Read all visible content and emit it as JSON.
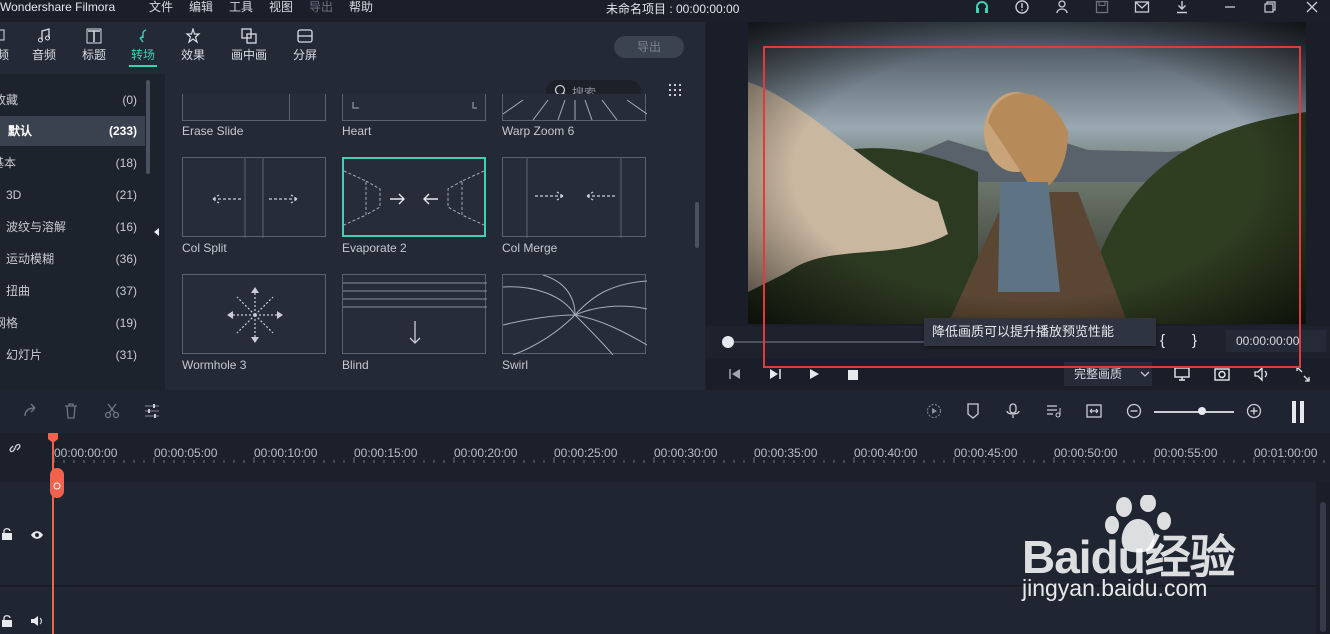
{
  "app": {
    "name": "Wondershare Filmora",
    "project_title": "未命名项目 : 00:00:00:00"
  },
  "menu": [
    "文件",
    "编辑",
    "工具",
    "视图",
    "导出",
    "帮助"
  ],
  "nav_tabs": [
    {
      "label": "频",
      "icon": "media-icon"
    },
    {
      "label": "音频",
      "icon": "music-note-icon"
    },
    {
      "label": "标题",
      "icon": "text-icon"
    },
    {
      "label": "转场",
      "icon": "transition-icon",
      "active": true
    },
    {
      "label": "效果",
      "icon": "effects-icon"
    },
    {
      "label": "画中画",
      "icon": "pip-icon"
    },
    {
      "label": "分屏",
      "icon": "split-screen-icon"
    }
  ],
  "export_label": "导出",
  "search_placeholder": "搜索",
  "categories": [
    {
      "name": "收藏",
      "count": "(0)"
    },
    {
      "name": "默认",
      "count": "(233)",
      "active": true
    },
    {
      "name": "基本",
      "count": "(18)"
    },
    {
      "name": "3D",
      "count": "(21)"
    },
    {
      "name": "波纹与溶解",
      "count": "(16)"
    },
    {
      "name": "运动模糊",
      "count": "(36)"
    },
    {
      "name": "扭曲",
      "count": "(37)"
    },
    {
      "name": "网格",
      "count": "(19)"
    },
    {
      "name": "幻灯片",
      "count": "(31)"
    }
  ],
  "transitions": [
    {
      "label": "Erase Slide"
    },
    {
      "label": "Heart"
    },
    {
      "label": "Warp Zoom 6"
    },
    {
      "label": "Col Split"
    },
    {
      "label": "Evaporate 2",
      "selected": true
    },
    {
      "label": "Col Merge"
    },
    {
      "label": "Wormhole 3"
    },
    {
      "label": "Blind"
    },
    {
      "label": "Swirl"
    }
  ],
  "player": {
    "tooltip": "降低画质可以提升播放预览性能",
    "timecode": "00:00:00:00",
    "quality": "完整画质",
    "progress": 0
  },
  "timeline": {
    "ruler": [
      "00:00:00:00",
      "00:00:05:00",
      "00:00:10:00",
      "00:00:15:00",
      "00:00:20:00",
      "00:00:25:00",
      "00:00:30:00",
      "00:00:35:00",
      "00:00:40:00",
      "00:00:45:00",
      "00:00:50:00",
      "00:00:55:00",
      "00:01:00:00"
    ],
    "zoom": 0.5
  },
  "watermark": {
    "brand": "Baidu经验",
    "url": "jingyan.baidu.com"
  },
  "colors": {
    "accent": "#3fd0b5",
    "highlight_box": "#e0393e",
    "playhead": "#f0624d"
  }
}
